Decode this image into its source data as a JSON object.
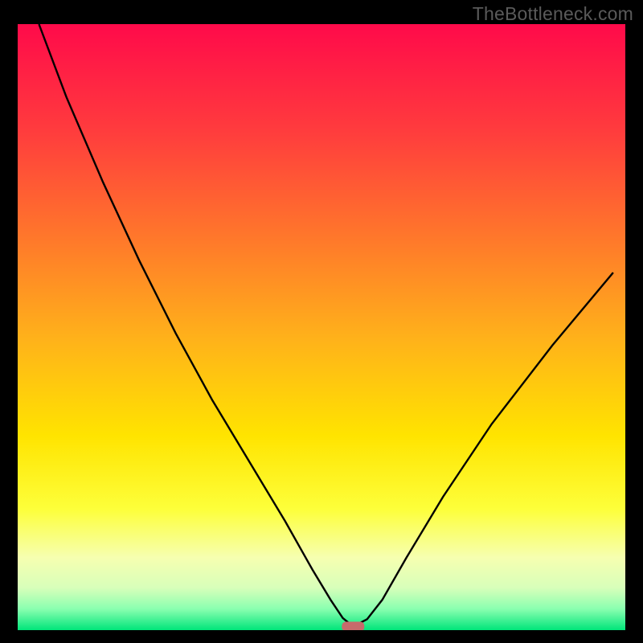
{
  "watermark": "TheBottleneck.com",
  "chart_data": {
    "type": "line",
    "title": "",
    "xlabel": "",
    "ylabel": "",
    "xlim": [
      0,
      100
    ],
    "ylim": [
      0,
      100
    ],
    "background": {
      "type": "vertical-gradient",
      "stops": [
        {
          "offset": 0.0,
          "color": "#ff0a4a"
        },
        {
          "offset": 0.18,
          "color": "#ff3d3d"
        },
        {
          "offset": 0.36,
          "color": "#ff7a2a"
        },
        {
          "offset": 0.52,
          "color": "#ffb21a"
        },
        {
          "offset": 0.68,
          "color": "#ffe400"
        },
        {
          "offset": 0.8,
          "color": "#fdff3a"
        },
        {
          "offset": 0.88,
          "color": "#f6ffb0"
        },
        {
          "offset": 0.93,
          "color": "#d8ffba"
        },
        {
          "offset": 0.965,
          "color": "#8affb0"
        },
        {
          "offset": 1.0,
          "color": "#00e57a"
        }
      ]
    },
    "series": [
      {
        "name": "bottleneck-curve",
        "x": [
          3.5,
          8,
          14,
          20,
          26,
          32,
          38,
          44,
          48.5,
          51.5,
          53.5,
          55.2,
          57.5,
          60,
          64,
          70,
          78,
          88,
          98
        ],
        "values": [
          100,
          88,
          74,
          61,
          49,
          38,
          28,
          18,
          10,
          5,
          2,
          0.6,
          1.8,
          5,
          12,
          22,
          34,
          47,
          59
        ]
      }
    ],
    "marker": {
      "name": "optimal-point",
      "x": 55.2,
      "y": 0.6,
      "color": "#c76b6b"
    },
    "frame_color": "#000000"
  }
}
